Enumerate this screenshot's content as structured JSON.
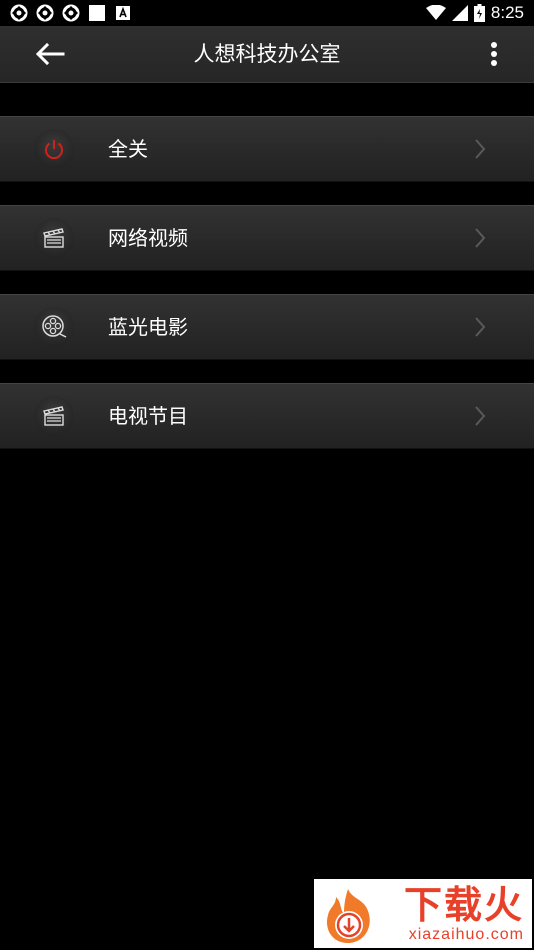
{
  "status_bar": {
    "time": "8:25",
    "left_icons": [
      "sync-icon",
      "sync-icon",
      "sync-icon",
      "square-icon",
      "font-a-icon"
    ],
    "right_icons": [
      "wifi-icon",
      "signal-icon",
      "battery-icon"
    ]
  },
  "toolbar": {
    "title": "人想科技办公室",
    "back_icon": "arrow-left-icon",
    "menu_icon": "more-vertical-icon"
  },
  "list": {
    "items": [
      {
        "label": "全关",
        "icon": "power-icon"
      },
      {
        "label": "网络视频",
        "icon": "clapperboard-icon"
      },
      {
        "label": "蓝光电影",
        "icon": "film-reel-icon"
      },
      {
        "label": "电视节目",
        "icon": "clapperboard-icon"
      }
    ]
  },
  "watermark": {
    "brand_cn": "下载火",
    "brand_en": "xiazaihuo.com"
  },
  "colors": {
    "accent_red": "#e8412a",
    "power_red": "#d0211c",
    "row_bg": "#2a2a2a",
    "toolbar_bg": "#2b2b2b"
  }
}
